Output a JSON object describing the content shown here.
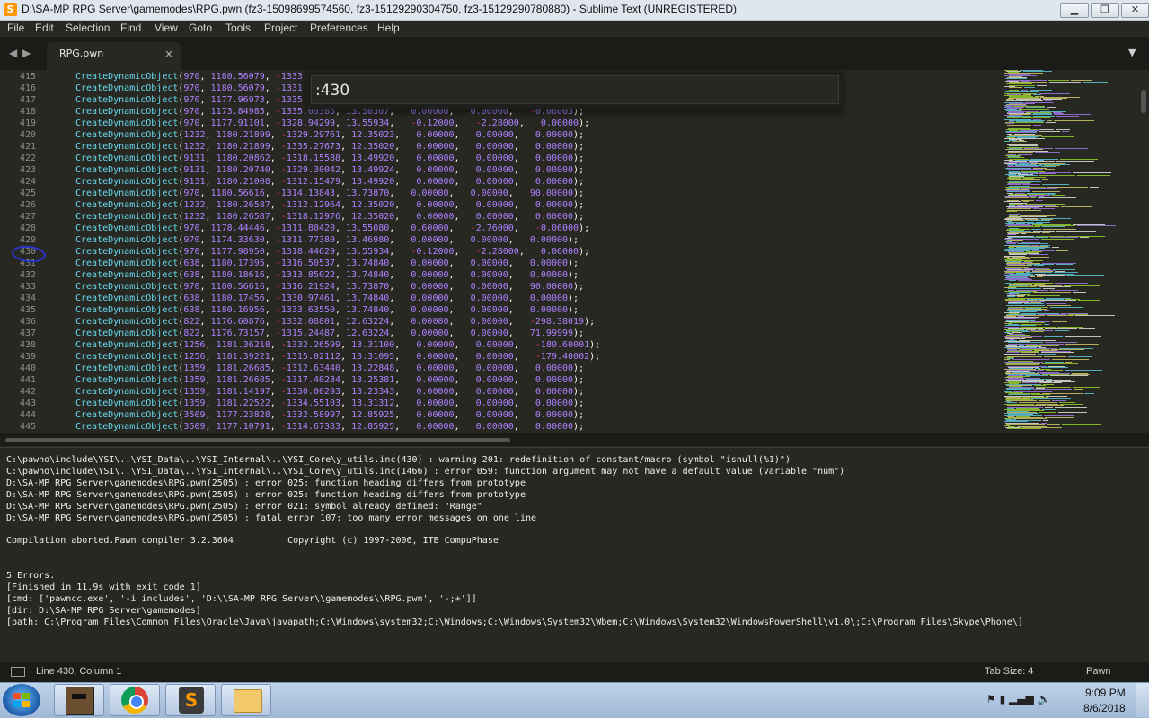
{
  "window": {
    "title": "D:\\SA-MP RPG Server\\gamemodes\\RPG.pwn (fz3-15098699574560, fz3-15129290304750, fz3-15129290780880) - Sublime Text (UNREGISTERED)",
    "app_icon": "S",
    "minimize": "▁",
    "maximize": "❐",
    "close": "✕"
  },
  "menu": [
    "File",
    "Edit",
    "Selection",
    "Find",
    "View",
    "Goto",
    "Tools",
    "Project",
    "Preferences",
    "Help"
  ],
  "tabs": {
    "nav_left": "◀",
    "nav_right": "▶",
    "active_label": "RPG.pwn",
    "close": "×",
    "dropdown": "▼"
  },
  "goto": {
    "value": ":430"
  },
  "editor": {
    "function": "CreateDynamicObject",
    "lines": [
      {
        "n": "415",
        "args": [
          "970",
          "1180.56079",
          "-1333"
        ],
        "hidden": true
      },
      {
        "n": "416",
        "args": [
          "970",
          "1180.56079",
          "-1331"
        ],
        "hidden": true
      },
      {
        "n": "417",
        "args": [
          "970",
          "1177.96973",
          "-1335"
        ],
        "hidden": true
      },
      {
        "n": "418",
        "args": [
          "970",
          "1173.84985",
          "-1335.09385",
          "13.50307",
          "0.00000",
          "0.00000",
          "-0.06003"
        ]
      },
      {
        "n": "419",
        "args": [
          "970",
          "1177.91101",
          "-1328.94299",
          "13.55934",
          "-0.12000",
          "-2.28000",
          "0.06000"
        ]
      },
      {
        "n": "420",
        "args": [
          "1232",
          "1180.21899",
          "-1329.29761",
          "12.35023",
          "0.00000",
          "0.00000",
          "0.00000"
        ]
      },
      {
        "n": "421",
        "args": [
          "1232",
          "1180.21899",
          "-1335.27673",
          "12.35020",
          "0.00000",
          "0.00000",
          "0.00000"
        ]
      },
      {
        "n": "422",
        "args": [
          "9131",
          "1180.20862",
          "-1318.15588",
          "13.49920",
          "0.00000",
          "0.00000",
          "0.00000"
        ]
      },
      {
        "n": "423",
        "args": [
          "9131",
          "1180.20740",
          "-1329.30042",
          "13.49924",
          "0.00000",
          "0.00000",
          "0.00000"
        ]
      },
      {
        "n": "424",
        "args": [
          "9131",
          "1180.21008",
          "-1312.15479",
          "13.49920",
          "0.00000",
          "0.00000",
          "0.00000"
        ]
      },
      {
        "n": "425",
        "args": [
          "970",
          "1180.56616",
          "-1314.13843",
          "13.73870",
          "0.00000",
          "0.00000",
          "90.00000"
        ]
      },
      {
        "n": "426",
        "args": [
          "1232",
          "1180.26587",
          "-1312.12964",
          "12.35020",
          "0.00000",
          "0.00000",
          "0.00000"
        ]
      },
      {
        "n": "427",
        "args": [
          "1232",
          "1180.26587",
          "-1318.12976",
          "12.35020",
          "0.00000",
          "0.00000",
          "0.00000"
        ]
      },
      {
        "n": "428",
        "args": [
          "970",
          "1178.44446",
          "-1311.80420",
          "13.55080",
          "0.60000",
          "-2.76000",
          "-0.06000"
        ]
      },
      {
        "n": "429",
        "args": [
          "970",
          "1174.33630",
          "-1311.77380",
          "13.46980",
          "0.00000",
          "0.00000",
          "0.00000"
        ]
      },
      {
        "n": "430",
        "args": [
          "970",
          "1177.98950",
          "-1318.44629",
          "13.55934",
          "-0.12000",
          "-2.28000",
          "0.06000"
        ]
      },
      {
        "n": "431",
        "args": [
          "638",
          "1180.17395",
          "-1316.50537",
          "13.74840",
          "0.00000",
          "0.00000",
          "0.00000"
        ]
      },
      {
        "n": "432",
        "args": [
          "638",
          "1180.18616",
          "-1313.85022",
          "13.74840",
          "0.00000",
          "0.00000",
          "0.00000"
        ]
      },
      {
        "n": "433",
        "args": [
          "970",
          "1180.56616",
          "-1316.21924",
          "13.73870",
          "0.00000",
          "0.00000",
          "90.00000"
        ]
      },
      {
        "n": "434",
        "args": [
          "638",
          "1180.17456",
          "-1330.97461",
          "13.74840",
          "0.00000",
          "0.00000",
          "0.00000"
        ]
      },
      {
        "n": "435",
        "args": [
          "638",
          "1180.16956",
          "-1333.63550",
          "13.74840",
          "0.00000",
          "0.00000",
          "0.00000"
        ]
      },
      {
        "n": "436",
        "args": [
          "822",
          "1176.60876",
          "-1332.08801",
          "12.63224",
          "0.00000",
          "0.00000",
          "-298.38019"
        ]
      },
      {
        "n": "437",
        "args": [
          "822",
          "1176.73157",
          "-1315.24487",
          "12.63224",
          "0.00000",
          "0.00000",
          "71.99999"
        ]
      },
      {
        "n": "438",
        "args": [
          "1256",
          "1181.36218",
          "-1332.26599",
          "13.31100",
          "0.00000",
          "0.00000",
          "-180.60001"
        ]
      },
      {
        "n": "439",
        "args": [
          "1256",
          "1181.39221",
          "-1315.02112",
          "13.31095",
          "0.00000",
          "0.00000",
          "-179.40002"
        ]
      },
      {
        "n": "440",
        "args": [
          "1359",
          "1181.26685",
          "-1312.63440",
          "13.22848",
          "0.00000",
          "0.00000",
          "0.00000"
        ]
      },
      {
        "n": "441",
        "args": [
          "1359",
          "1181.26685",
          "-1317.40234",
          "13.25381",
          "0.00000",
          "0.00000",
          "0.00000"
        ]
      },
      {
        "n": "442",
        "args": [
          "1359",
          "1181.14197",
          "-1330.00293",
          "13.23343",
          "0.00000",
          "0.00000",
          "0.00000"
        ]
      },
      {
        "n": "443",
        "args": [
          "1359",
          "1181.22522",
          "-1334.55103",
          "13.31312",
          "0.00000",
          "0.00000",
          "0.00000"
        ]
      },
      {
        "n": "444",
        "args": [
          "3509",
          "1177.23828",
          "-1332.58997",
          "12.85925",
          "0.00000",
          "0.00000",
          "0.00000"
        ]
      },
      {
        "n": "445",
        "args": [
          "3509",
          "1177.10791",
          "-1314.67383",
          "12.85925",
          "0.00000",
          "0.00000",
          "0.00000"
        ]
      }
    ]
  },
  "output": [
    "C:\\pawno\\include\\YSI\\..\\YSI_Data\\..\\YSI_Internal\\..\\YSI_Core\\y_utils.inc(430) : warning 201: redefinition of constant/macro (symbol \"isnull(%1)\")",
    "C:\\pawno\\include\\YSI\\..\\YSI_Data\\..\\YSI_Internal\\..\\YSI_Core\\y_utils.inc(1466) : error 059: function argument may not have a default value (variable \"num\")",
    "D:\\SA-MP RPG Server\\gamemodes\\RPG.pwn(2505) : error 025: function heading differs from prototype",
    "D:\\SA-MP RPG Server\\gamemodes\\RPG.pwn(2505) : error 025: function heading differs from prototype",
    "D:\\SA-MP RPG Server\\gamemodes\\RPG.pwn(2505) : error 021: symbol already defined: \"Range\"",
    "D:\\SA-MP RPG Server\\gamemodes\\RPG.pwn(2505) : fatal error 107: too many error messages on one line",
    "",
    "Compilation aborted.Pawn compiler 3.2.3664          Copyright (c) 1997-2006, ITB CompuPhase",
    "",
    "",
    "5 Errors.",
    "[Finished in 11.9s with exit code 1]",
    "[cmd: ['pawncc.exe', '-i includes', 'D:\\\\SA-MP RPG Server\\\\gamemodes\\\\RPG.pwn', '-;+']]",
    "[dir: D:\\SA-MP RPG Server\\gamemodes]",
    "[path: C:\\Program Files\\Common Files\\Oracle\\Java\\javapath;C:\\Windows\\system32;C:\\Windows;C:\\Windows\\System32\\Wbem;C:\\Windows\\System32\\WindowsPowerShell\\v1.0\\;C:\\Program Files\\Skype\\Phone\\]"
  ],
  "status": {
    "position": "Line 430, Column 1",
    "tab_size": "Tab Size: 4",
    "syntax": "Pawn"
  },
  "taskbar": {
    "tray_icons": [
      "flag-alert-icon",
      "power-icon",
      "network-signal-icon",
      "volume-icon"
    ],
    "tray_glyphs": "⚑ ▮ ▂▄▆ 🔈",
    "time": "9:09 PM",
    "date": "8/6/2018"
  },
  "colors": {
    "function": "#66d9ef",
    "number": "#ae81ff",
    "minus": "#f92672",
    "background": "#272822",
    "annotation_circle": "#2a34c8"
  }
}
